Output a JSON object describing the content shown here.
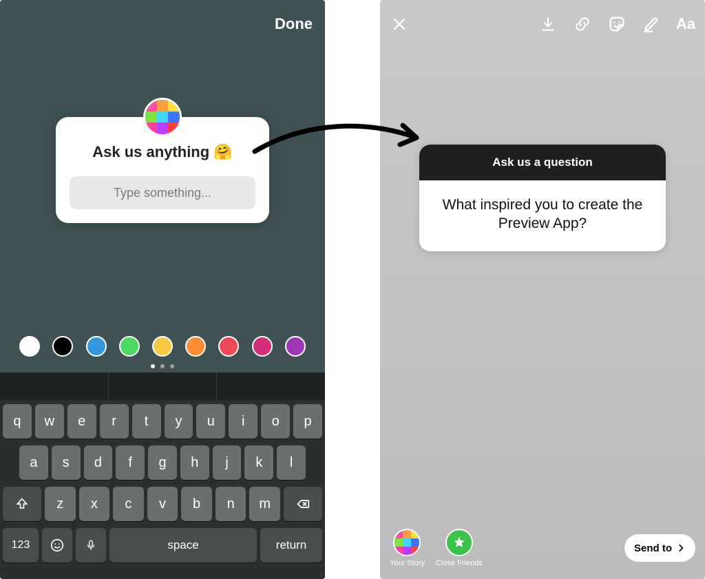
{
  "left": {
    "done_label": "Done",
    "sticker": {
      "prompt": "Ask us anything ",
      "emoji": "🤗",
      "placeholder": "Type something..."
    },
    "colors": [
      "#ffffff",
      "#000000",
      "#3598db",
      "#4bd864",
      "#f7c945",
      "#fd8c32",
      "#ee4a56",
      "#d22e7b",
      "#9f36b8"
    ],
    "page_dots": {
      "count": 3,
      "active": 0
    },
    "keyboard": {
      "row1": [
        "q",
        "w",
        "e",
        "r",
        "t",
        "y",
        "u",
        "i",
        "o",
        "p"
      ],
      "row2": [
        "a",
        "s",
        "d",
        "f",
        "g",
        "h",
        "j",
        "k",
        "l"
      ],
      "row3": [
        "z",
        "x",
        "c",
        "v",
        "b",
        "n",
        "m"
      ],
      "shift_label": "⇧",
      "backspace_label": "⌫",
      "numbers_label": "123",
      "emoji_label": "☺",
      "mic_label": "🎤",
      "space_label": "space",
      "return_label": "return"
    }
  },
  "right": {
    "sticker": {
      "head": "Ask us a question",
      "body": "What inspired you to create the Preview App?"
    },
    "your_story_label": "Your Story",
    "close_friends_label": "Close Friends",
    "send_to_label": "Send to"
  },
  "avatar_grid": [
    "#ff4fa0",
    "#ff9e3f",
    "#ffe23f",
    "#7fe23f",
    "#3fd6ff",
    "#3f74ff",
    "#ff3f9e",
    "#b83fff",
    "#ff3f3f"
  ]
}
